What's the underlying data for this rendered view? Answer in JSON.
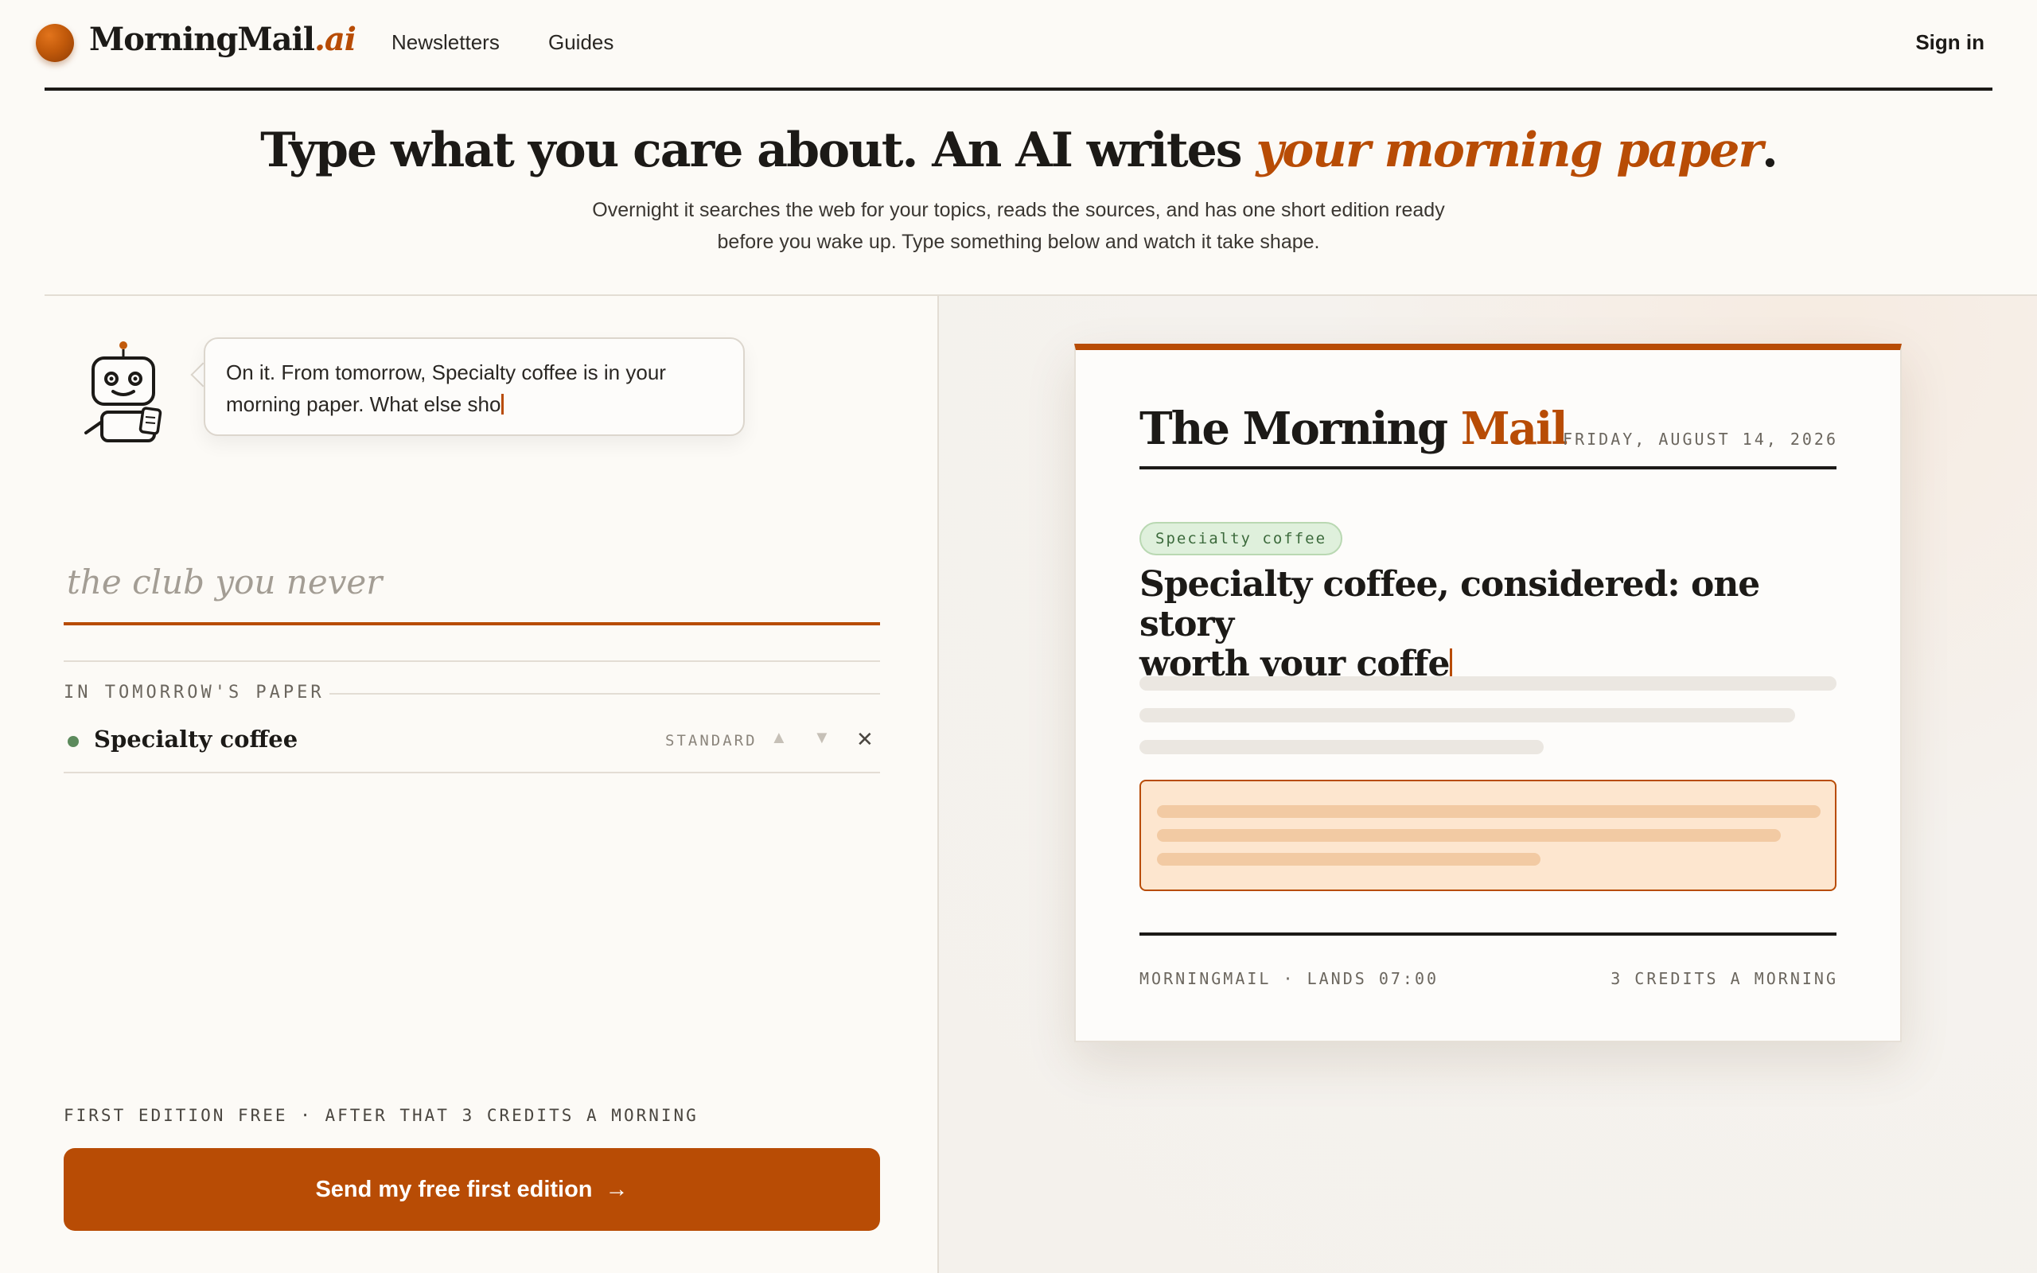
{
  "brand": {
    "name": "MorningMail",
    "suffix": ".ai"
  },
  "nav": {
    "items": [
      "Newsletters",
      "Guides"
    ],
    "sign_in": "Sign in"
  },
  "hero": {
    "title_main": "Type what you care about. An AI writes ",
    "title_accent": "your morning paper",
    "title_end": ".",
    "subtitle_line1": "Overnight it searches the web for your topics, reads the sources, and has one short edition ready",
    "subtitle_line2": "before you wake up. Type something below and watch it take shape."
  },
  "assistant": {
    "message_line1": "On it. From tomorrow, Specialty coffee is in your",
    "message_line2": "morning paper. What else sho"
  },
  "topic_input": {
    "placeholder": "the club you never",
    "value": ""
  },
  "tomorrow": {
    "label": "IN TOMORROW'S PAPER",
    "topics": [
      {
        "name": "Specialty coffee",
        "level": "STANDARD"
      }
    ]
  },
  "pricing_note": "FIRST EDITION FREE · AFTER THAT 3 CREDITS A MORNING",
  "cta": {
    "label": "Send my free first edition",
    "arrow": "→"
  },
  "preview": {
    "title_main": "The Morning ",
    "title_accent": "Mail",
    "date": "FRIDAY, AUGUST 14, 2026",
    "tag": "Specialty coffee",
    "headline_line1": "Specialty coffee, considered: one story",
    "headline_line2": "worth your coffe",
    "footer_left": "MORNINGMAIL · LANDS 07:00",
    "footer_right": "3 CREDITS A MORNING"
  },
  "colors": {
    "accent": "#b84c05",
    "background": "#fcfaf6",
    "tag_green": "#dff0dc",
    "callout": "#fde6cf"
  },
  "icons": [
    "logo-orb-icon",
    "robot-icon",
    "arrow-up-icon",
    "arrow-down-icon",
    "close-icon",
    "arrow-right-icon"
  ]
}
